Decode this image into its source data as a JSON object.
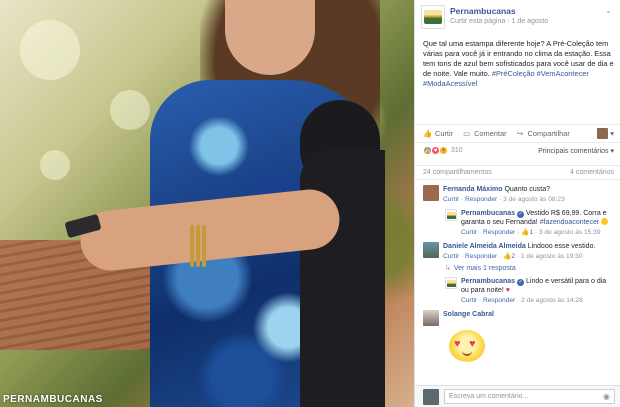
{
  "photo": {
    "brand": "PERNAMBUCANAS"
  },
  "post": {
    "page_name": "Pernambucanas",
    "like_page": "Curtir esta página",
    "separator": " · ",
    "date": "1 de agosto",
    "globe": "·",
    "menu": "⌄",
    "text": "Que tal uma estampa diferente hoje? A Pré-Coleção tem várias para você já ir entrando no clima da estação. Essa tem tons de azul bem sofisticados para você usar de dia e de noite. Vale muito. ",
    "tags": "#PréColeção #VemAcontecer #ModaAcessível"
  },
  "actions": {
    "like": "Curtir",
    "comment": "Comentar",
    "share": "Compartilhar",
    "caret": "▾"
  },
  "reactions": {
    "count": "310",
    "sort": "Principais comentários ▾"
  },
  "shares": {
    "shares": "24 compartilhamentos",
    "comments": "4 comentários"
  },
  "comments": [
    {
      "name": "Fernanda Máximo",
      "text": "Quanto custa?",
      "meta_like": "Curtir",
      "meta_reply": "Responder",
      "date": "3 de agosto às 08:23"
    },
    {
      "name": "Pernambucanas",
      "text": "Vestido R$ 69,99. Corra e garanta o seu Fernanda! ",
      "hashtag": "#fazendoacontecer",
      "meta_like": "Curtir",
      "meta_reply": "Responder",
      "likes": "1",
      "date": "3 de agosto às 15:39"
    },
    {
      "name": "Daniele Almeida Almeida",
      "text": "Lindooo esse vestido.",
      "meta_like": "Curtir",
      "meta_reply": "Responder",
      "likes": "2",
      "date": "1 de agosto às 19:30",
      "more": "Ver mais 1 resposta"
    },
    {
      "name": "Pernambucanas",
      "text": "Lindo e versátil para o dia ou para noite!",
      "meta_like": "Curtir",
      "meta_reply": "Responder",
      "date": "2 de agosto às 14:28"
    },
    {
      "name": "Solange Cabral"
    }
  ],
  "write": {
    "placeholder": "Escreva um comentário...",
    "camera": "◉"
  },
  "colors": {
    "link": "#365899",
    "accent": "#4267b2",
    "love": "#f25268"
  }
}
